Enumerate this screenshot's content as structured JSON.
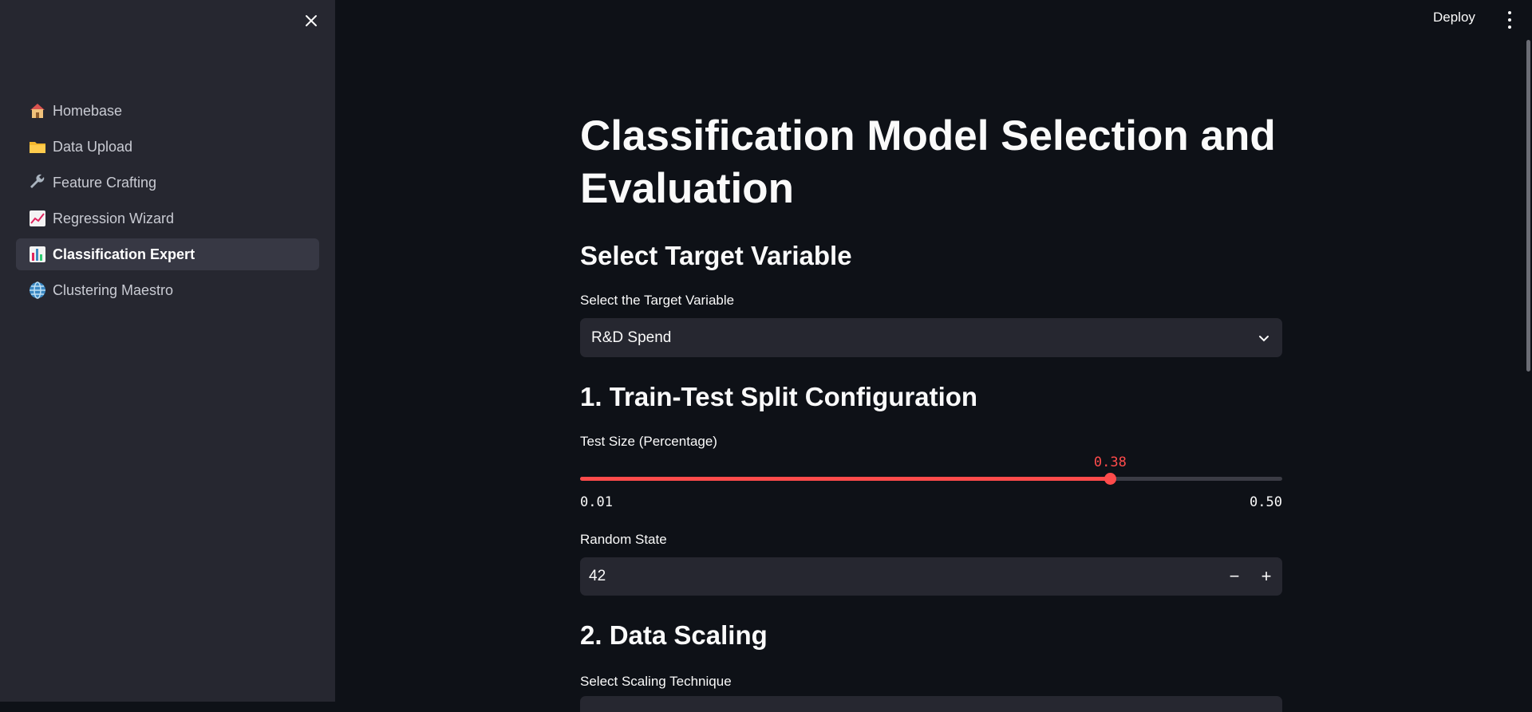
{
  "header": {
    "deploy_label": "Deploy"
  },
  "sidebar": {
    "items": [
      {
        "label": "Homebase",
        "icon": "house-icon",
        "active": false
      },
      {
        "label": "Data Upload",
        "icon": "folder-icon",
        "active": false
      },
      {
        "label": "Feature Crafting",
        "icon": "wrench-icon",
        "active": false
      },
      {
        "label": "Regression Wizard",
        "icon": "chart-increasing-icon",
        "active": false
      },
      {
        "label": "Classification Expert",
        "icon": "bar-chart-icon",
        "active": true
      },
      {
        "label": "Clustering Maestro",
        "icon": "globe-icon",
        "active": false
      }
    ]
  },
  "main": {
    "title": "Classification Model Selection and Evaluation",
    "target_section": {
      "heading": "Select Target Variable",
      "select_label": "Select the Target Variable",
      "select_value": "R&D Spend"
    },
    "split_section": {
      "heading": "1. Train-Test Split Configuration",
      "slider_label": "Test Size (Percentage)",
      "slider_value": "0.38",
      "slider_min": "0.01",
      "slider_max": "0.50",
      "slider_fraction": 0.755,
      "random_state_label": "Random State",
      "random_state_value": "42",
      "minus_label": "−",
      "plus_label": "+"
    },
    "scaling_section": {
      "heading": "2. Data Scaling",
      "select_label": "Select Scaling Technique"
    }
  },
  "colors": {
    "accent": "#ff4b4b",
    "background": "#0e1117",
    "sidebar": "#262730",
    "input": "#262730"
  }
}
